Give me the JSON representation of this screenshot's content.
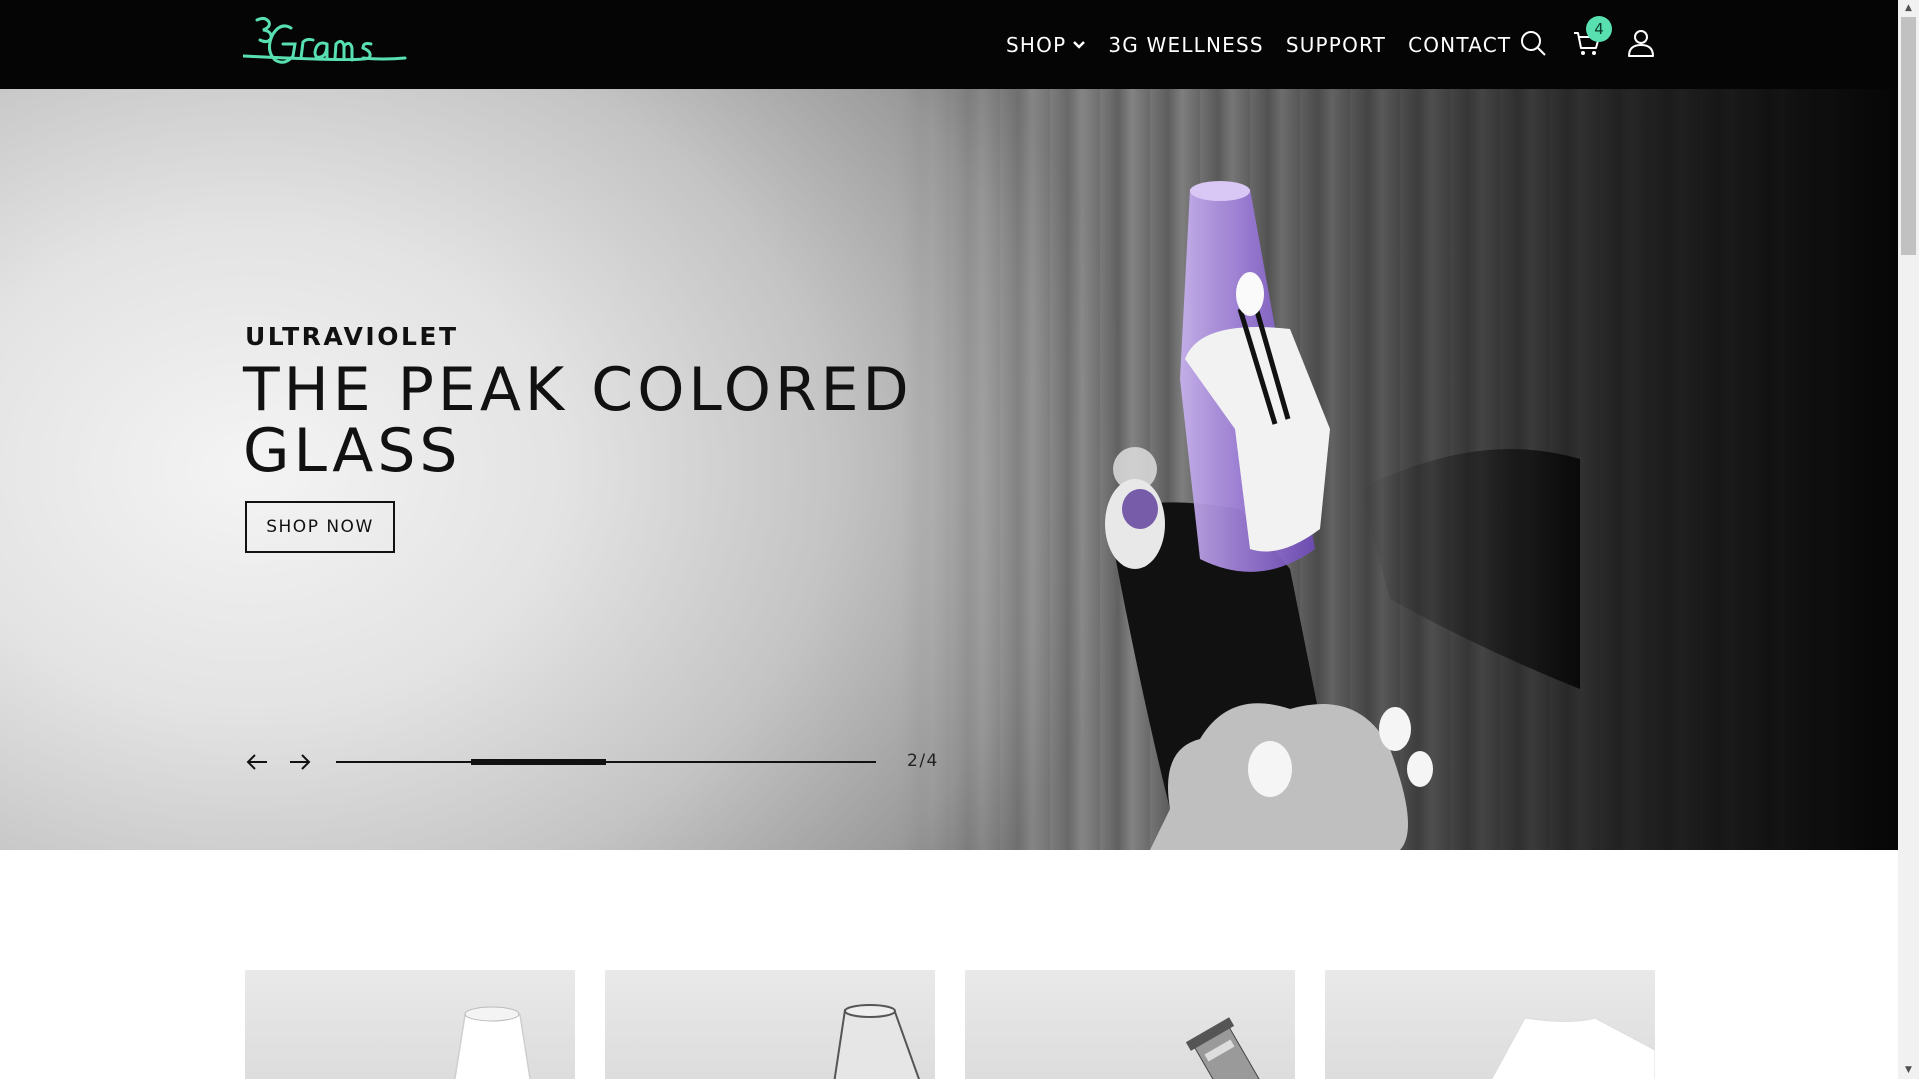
{
  "brand": {
    "logo_text": "3Grams",
    "logo_color": "#58e0b1"
  },
  "nav": {
    "items": [
      {
        "label": "SHOP",
        "has_dropdown": true
      },
      {
        "label": "3G WELLNESS"
      },
      {
        "label": "SUPPORT"
      },
      {
        "label": "CONTACT"
      }
    ]
  },
  "header_icons": {
    "search": "search-icon",
    "cart": "cart-icon",
    "cart_count": "4",
    "account": "user-icon"
  },
  "hero": {
    "eyebrow": "ULTRAVIOLET",
    "headline": "THE PEAK COLORED GLASS",
    "cta_label": "SHOP NOW",
    "slide_counter": "2/4",
    "current_slide": 2,
    "total_slides": 4,
    "accent_color": "#9b7ad8"
  },
  "products": [
    {
      "icon": "glass-attachment-image"
    },
    {
      "icon": "glass-top-image"
    },
    {
      "icon": "atomizer-image"
    },
    {
      "icon": "tshirt-image"
    }
  ],
  "colors": {
    "header_bg": "#050505",
    "badge": "#58e0b1",
    "text": "#111111"
  }
}
